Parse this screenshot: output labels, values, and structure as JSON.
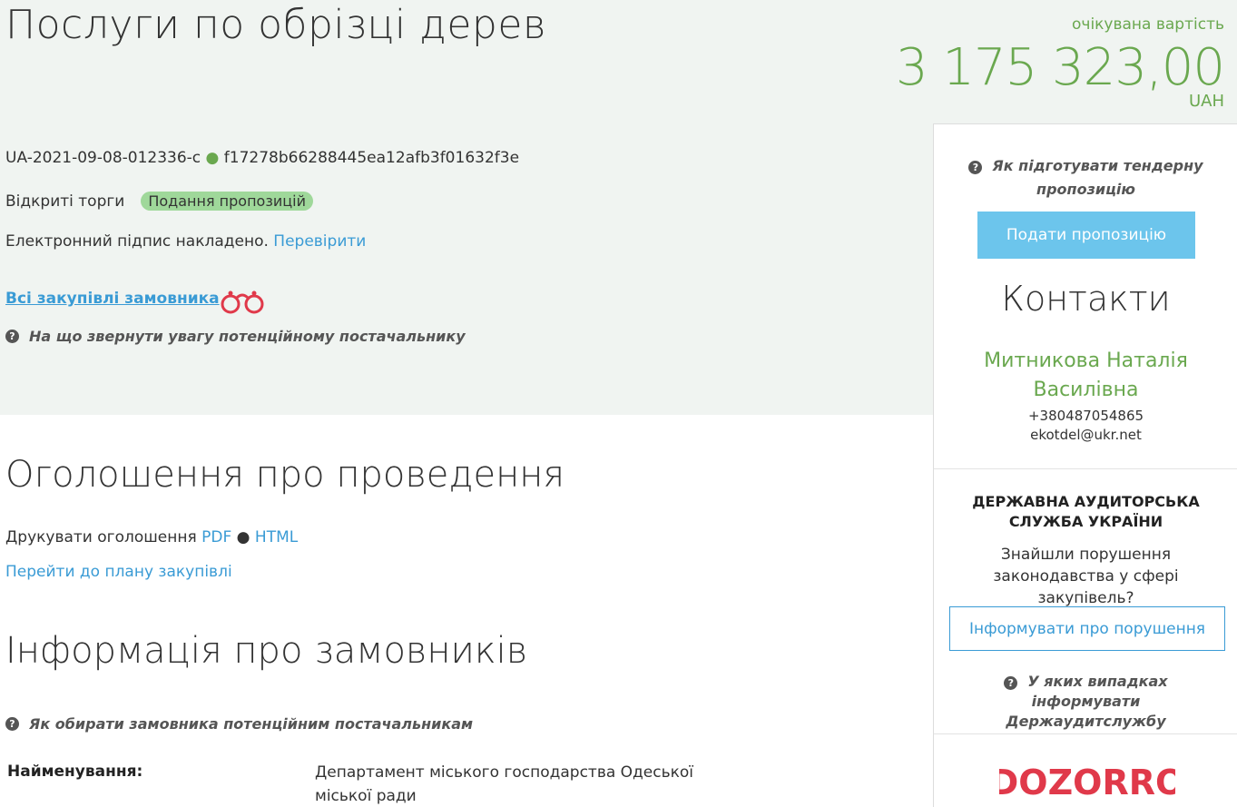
{
  "header": {
    "title": "Послуги по обрізці дерев",
    "expected_label": "очікувана вартість",
    "amount": "3 175 323,00",
    "currency": "UAH"
  },
  "tender": {
    "id": "UA-2021-09-08-012336-c",
    "separator": "●",
    "hash": "f17278b66288445ea12afb3f01632f3e",
    "procedure": "Відкриті торги",
    "status": "Подання пропозицій",
    "signature_text": "Електронний підпис накладено.",
    "verify_link": "Перевірити",
    "all_purchases_link": "Всі закупівлі замовника",
    "hint_supplier": "На що звернути увагу потенційному постачальнику"
  },
  "announcement": {
    "title": "Оголошення про проведення",
    "print_label": "Друкувати оголошення",
    "pdf_link": "PDF",
    "separator": "●",
    "html_link": "HTML",
    "plan_link": "Перейти до плану закупівлі"
  },
  "customers": {
    "title": "Інформація про замовників",
    "hint": "Як обирати замовника потенційним постачальникам",
    "name_label": "Найменування:",
    "name_value": "Департамент міського господарства Одеської міської ради"
  },
  "sidebar": {
    "prepare_hint": "Як підготувати тендерну пропозицію",
    "submit_button": "Подати пропозицію",
    "contacts_title": "Контакти",
    "contact_name": "Митникова Наталія Василівна",
    "contact_phone": "+380487054865",
    "contact_email": "ekotdel@ukr.net",
    "audit_title": "ДЕРЖАВНА АУДИТОРСЬКА СЛУЖБА УКРАЇНИ",
    "audit_question": "Знайшли порушення законодавства у сфері закупівель?",
    "report_button": "Інформувати про порушення",
    "audit_hint": "У яких випадках інформувати Держаудитслужбу",
    "logo_text": "DOZORRO"
  },
  "colors": {
    "accent_green": "#6aa84f",
    "link_blue": "#3a9bd5",
    "button_blue": "#6cc5ec",
    "badge_green": "#9fd89a",
    "logo_red": "#e0394a"
  }
}
